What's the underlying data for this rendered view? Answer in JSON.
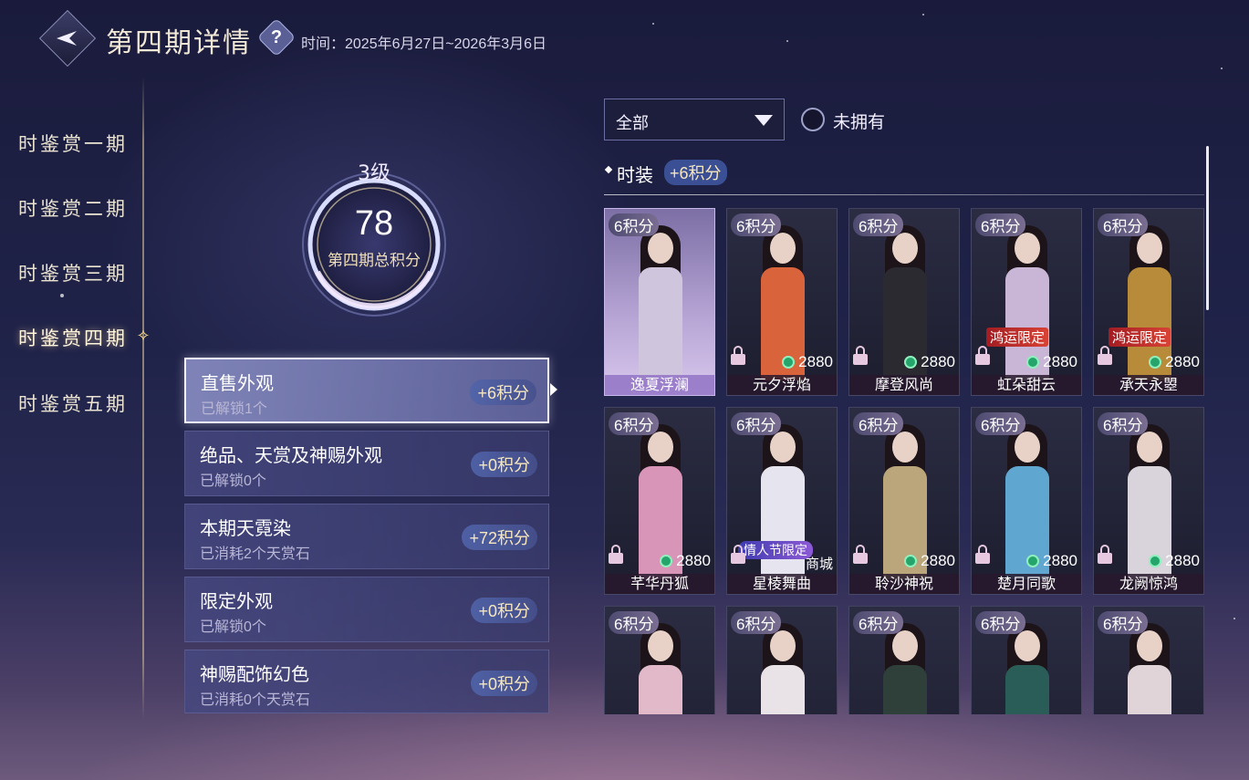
{
  "header": {
    "title": "第四期详情",
    "help_icon": "?",
    "time_label": "时间：2025年6月27日~2026年3月6日"
  },
  "sidebar": {
    "items": [
      {
        "label": "时鉴赏一期"
      },
      {
        "label": "时鉴赏二期"
      },
      {
        "label": "时鉴赏三期"
      },
      {
        "label": "时鉴赏四期",
        "active": true
      },
      {
        "label": "时鉴赏五期"
      }
    ]
  },
  "summary": {
    "level": "3级",
    "score": "78",
    "score_label": "第四期总积分"
  },
  "categories": [
    {
      "title": "直售外观",
      "sub": "已解锁1个",
      "points": "+6积分",
      "active": true
    },
    {
      "title": "绝品、天赏及神赐外观",
      "sub": "已解锁0个",
      "points": "+0积分"
    },
    {
      "title": "本期天霓染",
      "sub": "已消耗2个天赏石",
      "points": "+72积分"
    },
    {
      "title": "限定外观",
      "sub": "已解锁0个",
      "points": "+0积分"
    },
    {
      "title": "神赐配饰幻色",
      "sub": "已消耗0个天赏石",
      "points": "+0积分"
    }
  ],
  "filter": {
    "selected": "全部",
    "not_owned_label": "未拥有"
  },
  "section": {
    "title": "时装",
    "points": "+6积分"
  },
  "items": [
    {
      "name": "逸夏浮澜",
      "points": "6积分",
      "owned": true,
      "outfit_color": "#cfc6de"
    },
    {
      "name": "元夕浮焰",
      "points": "6积分",
      "price": "2880",
      "outfit_color": "#d9643c"
    },
    {
      "name": "摩登风尚",
      "points": "6积分",
      "price": "2880",
      "outfit_color": "#2a2a30"
    },
    {
      "name": "虹朵甜云",
      "points": "6积分",
      "price": "2880",
      "tag": "鸿运限定",
      "outfit_color": "#c9b5d6"
    },
    {
      "name": "承天永曌",
      "points": "6积分",
      "price": "2880",
      "tag": "鸿运限定",
      "outfit_color": "#b88b3a"
    },
    {
      "name": "芊华丹狐",
      "points": "6积分",
      "price": "2880",
      "outfit_color": "#d895b8"
    },
    {
      "name": "星棱舞曲",
      "points": "6积分",
      "shop": "商城",
      "tag2": "情人节限定",
      "outfit_color": "#e6e4ee"
    },
    {
      "name": "聆沙神祝",
      "points": "6积分",
      "price": "2880",
      "outfit_color": "#bba57a"
    },
    {
      "name": "楚月同歌",
      "points": "6积分",
      "price": "2880",
      "outfit_color": "#5fa6d0"
    },
    {
      "name": "龙阙惊鸿",
      "points": "6积分",
      "price": "2880",
      "outfit_color": "#d9d4dc"
    },
    {
      "name": "",
      "points": "6积分",
      "outfit_color": "#e2b9c9"
    },
    {
      "name": "",
      "points": "6积分",
      "outfit_color": "#e9e2e6"
    },
    {
      "name": "",
      "points": "6积分",
      "outfit_color": "#2f3f3a"
    },
    {
      "name": "",
      "points": "6积分",
      "outfit_color": "#2b5d58"
    },
    {
      "name": "",
      "points": "6积分",
      "outfit_color": "#e0d4d8"
    }
  ]
}
